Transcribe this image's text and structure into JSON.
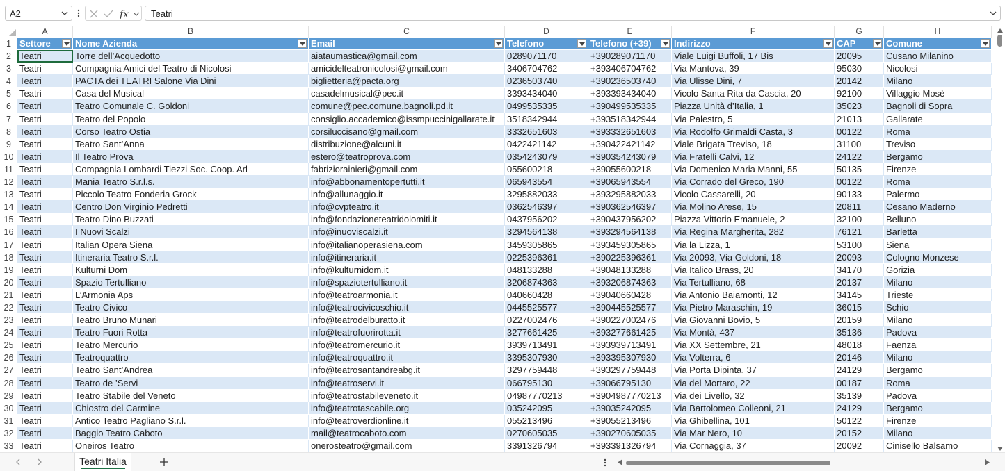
{
  "formula_bar": {
    "name_box": "A2",
    "formula": "Teatri"
  },
  "columns": [
    "A",
    "B",
    "C",
    "D",
    "E",
    "F",
    "G",
    "H"
  ],
  "headers": [
    "Settore",
    "Nome Azienda",
    "Email",
    "Telefono",
    "Telefono (+39)",
    "Indirizzo",
    "CAP",
    "Comune"
  ],
  "rows": [
    {
      "n": "2",
      "c": [
        "Teatri",
        "Torre dell’Acquedotto",
        "aiataumastica@gmail.com",
        "0289071170",
        "+390289071170",
        "Viale Luigi Buffoli, 17 Bis",
        "20095",
        "Cusano Milanino"
      ]
    },
    {
      "n": "3",
      "c": [
        "Teatri",
        "Compagnia Amici del Teatro di Nicolosi",
        "amicidelteatronicolosi@gmail.com",
        "3406704762",
        "+393406704762",
        "Via Mantova, 39",
        "95030",
        "Nicolosi"
      ]
    },
    {
      "n": "4",
      "c": [
        "Teatri",
        "PACTA dei TEATRI Salone Via Dini",
        "biglietteria@pacta.org",
        "0236503740",
        "+390236503740",
        "Via Ulisse Dini, 7",
        "20142",
        "Milano"
      ]
    },
    {
      "n": "5",
      "c": [
        "Teatri",
        "Casa del Musical",
        "casadelmusical@pec.it",
        "3393434040",
        "+393393434040",
        "Vicolo Santa Rita da Cascia, 20",
        "92100",
        "Villaggio Mosè"
      ]
    },
    {
      "n": "6",
      "c": [
        "Teatri",
        "Teatro Comunale C. Goldoni",
        "comune@pec.comune.bagnoli.pd.it",
        "0499535335",
        "+390499535335",
        "Piazza Unità d’Italia, 1",
        "35023",
        "Bagnoli di Sopra"
      ]
    },
    {
      "n": "7",
      "c": [
        "Teatri",
        "Teatro del Popolo",
        "consiglio.accademico@issmpuccinigallarate.it",
        "3518342944",
        "+393518342944",
        "Via Palestro, 5",
        "21013",
        "Gallarate"
      ]
    },
    {
      "n": "8",
      "c": [
        "Teatri",
        "Corso Teatro Ostia",
        "corsiluccisano@gmail.com",
        "3332651603",
        "+393332651603",
        "Via Rodolfo Grimaldi Casta, 3",
        "00122",
        "Roma"
      ]
    },
    {
      "n": "9",
      "c": [
        "Teatri",
        "Teatro Sant’Anna",
        "distribuzione@alcuni.it",
        "0422421142",
        "+390422421142",
        "Viale Brigata Treviso, 18",
        "31100",
        "Treviso"
      ]
    },
    {
      "n": "10",
      "c": [
        "Teatri",
        "Il Teatro Prova",
        "estero@teatroprova.com",
        "0354243079",
        "+390354243079",
        "Via Fratelli Calvi, 12",
        "24122",
        "Bergamo"
      ]
    },
    {
      "n": "11",
      "c": [
        "Teatri",
        "Compagnia Lombardi Tiezzi Soc. Coop. Arl",
        "fabriziorainieri@gmail.com",
        "055600218",
        "+39055600218",
        "Via Domenico Maria Manni, 55",
        "50135",
        "Firenze"
      ]
    },
    {
      "n": "12",
      "c": [
        "Teatri",
        "Mania Teatro S.r.l.s.",
        "info@abbonamentopertutti.it",
        "065943554",
        "+39065943554",
        "Via Corrado del Greco, 190",
        "00122",
        "Roma"
      ]
    },
    {
      "n": "13",
      "c": [
        "Teatri",
        "Piccolo Teatro Fonderia Grock",
        "info@allunaggio.it",
        "3295882033",
        "+393295882033",
        "Vicolo Cassarelli, 20",
        "90133",
        "Palermo"
      ]
    },
    {
      "n": "14",
      "c": [
        "Teatri",
        "Centro Don Virginio Pedretti",
        "info@cvpteatro.it",
        "0362546397",
        "+390362546397",
        "Via Molino Arese, 15",
        "20811",
        "Cesano Maderno"
      ]
    },
    {
      "n": "15",
      "c": [
        "Teatri",
        "Teatro Dino Buzzati",
        "info@fondazioneteatridolomiti.it",
        "0437956202",
        "+390437956202",
        "Piazza Vittorio Emanuele, 2",
        "32100",
        "Belluno"
      ]
    },
    {
      "n": "16",
      "c": [
        "Teatri",
        "I Nuovi Scalzi",
        "info@inuoviscalzi.it",
        "3294564138",
        "+393294564138",
        "Via Regina Margherita, 282",
        "76121",
        "Barletta"
      ]
    },
    {
      "n": "17",
      "c": [
        "Teatri",
        "Italian Opera Siena",
        "info@italianoperasiena.com",
        "3459305865",
        "+393459305865",
        "Via la Lizza, 1",
        "53100",
        "Siena"
      ]
    },
    {
      "n": "18",
      "c": [
        "Teatri",
        "Itineraria Teatro S.r.l.",
        "info@itineraria.it",
        "0225396361",
        "+390225396361",
        "Via 20093, Via Goldoni, 18",
        "20093",
        "Cologno Monzese"
      ]
    },
    {
      "n": "19",
      "c": [
        "Teatri",
        "Kulturni Dom",
        "info@kulturnidom.it",
        "048133288",
        "+39048133288",
        "Via Italico Brass, 20",
        "34170",
        "Gorizia"
      ]
    },
    {
      "n": "20",
      "c": [
        "Teatri",
        "Spazio Tertulliano",
        "info@spaziotertulliano.it",
        "3206874363",
        "+393206874363",
        "Via Tertulliano, 68",
        "20137",
        "Milano"
      ]
    },
    {
      "n": "21",
      "c": [
        "Teatri",
        "L’Armonia Aps",
        "info@teatroarmonia.it",
        "040660428",
        "+39040660428",
        "Via Antonio Baiamonti, 12",
        "34145",
        "Trieste"
      ]
    },
    {
      "n": "22",
      "c": [
        "Teatri",
        "Teatro Civico",
        "info@teatrocivicoschio.it",
        "0445525577",
        "+390445525577",
        "Via Pietro Maraschin, 19",
        "36015",
        "Schio"
      ]
    },
    {
      "n": "23",
      "c": [
        "Teatri",
        "Teatro Bruno Munari",
        "info@teatrodelburatto.it",
        "0227002476",
        "+390227002476",
        "Via Giovanni Bovio, 5",
        "20159",
        "Milano"
      ]
    },
    {
      "n": "24",
      "c": [
        "Teatri",
        "Teatro Fuori Rotta",
        "info@teatrofuorirotta.it",
        "3277661425",
        "+393277661425",
        "Via Montà, 437",
        "35136",
        "Padova"
      ]
    },
    {
      "n": "25",
      "c": [
        "Teatri",
        "Teatro Mercurio",
        "info@teatromercurio.it",
        "3939713491",
        "+393939713491",
        "Via XX Settembre, 21",
        "48018",
        "Faenza"
      ]
    },
    {
      "n": "26",
      "c": [
        "Teatri",
        "Teatroquattro",
        "info@teatroquattro.it",
        "3395307930",
        "+393395307930",
        "Via Volterra, 6",
        "20146",
        "Milano"
      ]
    },
    {
      "n": "27",
      "c": [
        "Teatri",
        "Teatro Sant’Andrea",
        "info@teatrosantandreabg.it",
        "3297759448",
        "+393297759448",
        "Via Porta Dipinta, 37",
        "24129",
        "Bergamo"
      ]
    },
    {
      "n": "28",
      "c": [
        "Teatri",
        "Teatro de ’Servi",
        "info@teatroservi.it",
        "066795130",
        "+39066795130",
        "Via del Mortaro, 22",
        "00187",
        "Roma"
      ]
    },
    {
      "n": "29",
      "c": [
        "Teatri",
        "Teatro Stabile del Veneto",
        "info@teatrostabileveneto.it",
        "04987770213",
        "+3904987770213",
        "Via dei Livello, 32",
        "35139",
        "Padova"
      ]
    },
    {
      "n": "30",
      "c": [
        "Teatri",
        "Chiostro del Carmine",
        "info@teatrotascabile.org",
        "035242095",
        "+39035242095",
        "Via Bartolomeo Colleoni, 21",
        "24129",
        "Bergamo"
      ]
    },
    {
      "n": "31",
      "c": [
        "Teatri",
        "Antico Teatro Pagliano S.r.l.",
        "info@teatroverdionline.it",
        "055213496",
        "+39055213496",
        "Via Ghibellina, 101",
        "50122",
        "Firenze"
      ]
    },
    {
      "n": "32",
      "c": [
        "Teatri",
        "Baggio Teatro Caboto",
        "mail@teatrocaboto.com",
        "0270605035",
        "+390270605035",
        "Via Mar Nero, 10",
        "20152",
        "Milano"
      ]
    },
    {
      "n": "33",
      "c": [
        "Teatri",
        "Oneiros Teatro",
        "onerosteatro@gmail.com",
        "3391326794",
        "+393391326794",
        "Via Cornaggia, 37",
        "20092",
        "Cinisello Balsamo"
      ]
    }
  ],
  "sheet_tab": "Teatri Italia",
  "colors": {
    "header_fill": "#5b9bd5",
    "band_fill": "#dbe8f6",
    "active_tab_underline": "#1e7145"
  }
}
